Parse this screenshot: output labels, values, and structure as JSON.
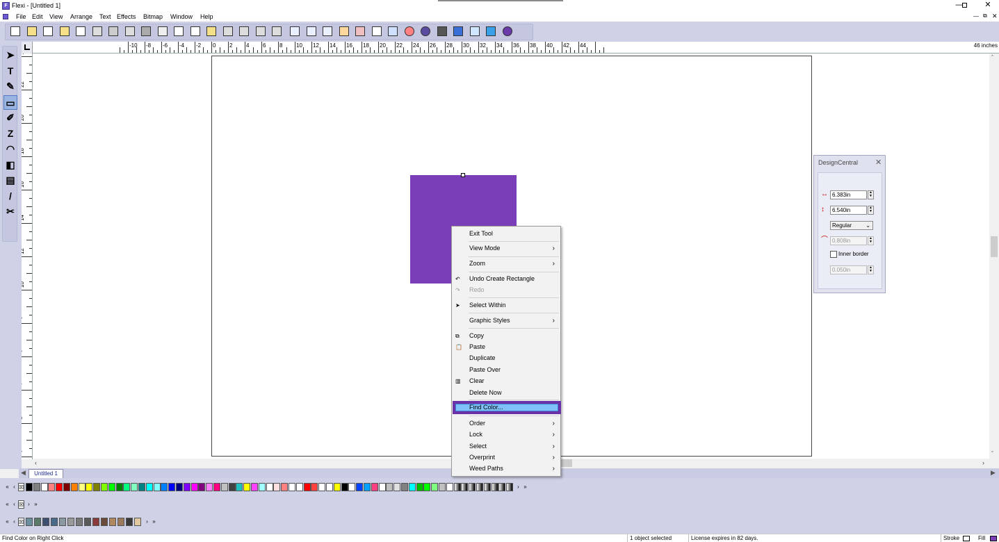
{
  "window": {
    "title": "Flexi - [Untitled 1]",
    "app_icon": "flexi-logo-icon",
    "controls": [
      "minimize-icon",
      "restore-icon",
      "close-icon"
    ]
  },
  "menu": {
    "items": [
      "File",
      "Edit",
      "View",
      "Arrange",
      "Text",
      "Effects",
      "Bitmap",
      "Window",
      "Help"
    ]
  },
  "toolbar": {
    "buttons": [
      "new-icon",
      "open-icon",
      "save-icon",
      "save-as-icon",
      "import-icon",
      "print-icon",
      "cut-to-plotter-icon",
      "rip-print-icon",
      "rip-disabled-icon",
      "production-manager-icon",
      "cut-icon",
      "copy-icon",
      "paste-icon",
      "undo-icon",
      "undo-more-icon",
      "redo-icon",
      "redo-more-icon",
      "design-central-icon",
      "align-icon",
      "group-icon",
      "color-palette-icon",
      "color-picker-icon",
      "swatch-grid-icon",
      "bitmap-icon",
      "color-wheel-icon",
      "er-badge-icon",
      "stripes-icon",
      "edit-icon",
      "cloud-sync-icon",
      "upload-icon",
      "plugin-icon"
    ]
  },
  "ruler": {
    "units": "46 inches",
    "top_labels": [
      "-10",
      "-8",
      "-6",
      "-4",
      "-2",
      "0",
      "2",
      "4",
      "6",
      "8",
      "10",
      "12",
      "14",
      "16",
      "18",
      "20",
      "22",
      "24",
      "26",
      "28",
      "30",
      "32",
      "34",
      "36",
      "38",
      "40",
      "42",
      "44"
    ],
    "left_labels": [
      "24",
      "22",
      "20",
      "18",
      "16",
      "14",
      "12",
      "10",
      "8",
      "6",
      "4",
      "2",
      "0"
    ]
  },
  "tools": [
    "select-tool-icon",
    "text-tool-icon",
    "shape-edit-tool-icon",
    "rectangle-tool-icon",
    "fill-tool-icon",
    "zigzag-tool-icon",
    "contour-tool-icon",
    "shadow-tool-icon",
    "measure-tool-icon",
    "eyedropper-tool-icon",
    "knife-tool-icon"
  ],
  "canvas": {
    "shape_color": "#7a3fb8"
  },
  "context_menu": {
    "items": [
      {
        "label": "Exit Tool",
        "submenu": false,
        "icon": ""
      },
      {
        "label": "View Mode",
        "submenu": true,
        "icon": ""
      },
      {
        "label": "Zoom",
        "submenu": true,
        "icon": ""
      },
      {
        "label": "Undo Create Rectangle",
        "submenu": false,
        "icon": "undo-icon"
      },
      {
        "label": "Redo",
        "submenu": false,
        "icon": "redo-icon",
        "disabled": true
      },
      {
        "label": "Select Within",
        "submenu": false,
        "icon": "select-arrow-icon"
      },
      {
        "label": "Graphic Styles",
        "submenu": true,
        "icon": ""
      },
      {
        "label": "Copy",
        "submenu": false,
        "icon": "copy-icon"
      },
      {
        "label": "Paste",
        "submenu": false,
        "icon": "paste-icon"
      },
      {
        "label": "Duplicate",
        "submenu": false,
        "icon": ""
      },
      {
        "label": "Paste Over",
        "submenu": false,
        "icon": ""
      },
      {
        "label": "Clear",
        "submenu": false,
        "icon": "clear-icon"
      },
      {
        "label": "Delete Now",
        "submenu": false,
        "icon": ""
      },
      {
        "label": "Find Color...",
        "submenu": false,
        "icon": "",
        "highlighted": true
      },
      {
        "label": "Order",
        "submenu": true,
        "icon": ""
      },
      {
        "label": "Lock",
        "submenu": true,
        "icon": ""
      },
      {
        "label": "Select",
        "submenu": true,
        "icon": ""
      },
      {
        "label": "Overprint",
        "submenu": true,
        "icon": ""
      },
      {
        "label": "Weed Paths",
        "submenu": true,
        "icon": ""
      }
    ],
    "submenu_arrow": "›",
    "highlight_color": "#6b31a8"
  },
  "design_central": {
    "title": "DesignCentral",
    "width_value": "6.383in",
    "height_value": "6.540in",
    "corner_style": "Regular",
    "corner_radius": "0.808in",
    "inner_border_label": "Inner border",
    "inner_border_value": "0.050in"
  },
  "tabs": {
    "document": "Untitled 1"
  },
  "palette": {
    "row1": [
      "#000000",
      "#808080",
      "#ffffff",
      "#ff8080",
      "#ff0000",
      "#800000",
      "#ff8000",
      "#ffff80",
      "#ffff00",
      "#808000",
      "#80ff00",
      "#00ff00",
      "#008000",
      "#00ff80",
      "#80ffc0",
      "#008080",
      "#00ffff",
      "#80ffff",
      "#0080ff",
      "#0000ff",
      "#000080",
      "#8000ff",
      "#ff00ff",
      "#800080",
      "#ff80ff",
      "#ff0080",
      "#c0c0c0",
      "#404040"
    ],
    "row1_patterns": [
      "#20c0c0",
      "#ffff00",
      "#ff40ff",
      "#a0ffff",
      "#ffffff",
      "#ffe0e0",
      "#ff8080",
      "#ffffff",
      "#ffffff",
      "#ff0000",
      "#ff4040",
      "#ffffff",
      "#ffffff",
      "#ffff00",
      "#000000",
      "#ffffff",
      "#0040ff",
      "#00a0ff",
      "#ff4080",
      "#ffffff",
      "#c0c0c0",
      "#e0e0e0",
      "#808080",
      "#00ffff",
      "#00c000",
      "#00ff00",
      "#80ff80",
      "#c0c0c0",
      "#ffffff"
    ],
    "row3": [
      "#6b8f9f",
      "#5b7a6a",
      "#3f4f6f",
      "#4a6a8a",
      "#8a9aa0",
      "#9a9a9a",
      "#7a7a7a",
      "#5a5a5a",
      "#8a3a3a",
      "#6a4a3a",
      "#b08860",
      "#9a7a5a",
      "#3a3a3a",
      "#e0c8a0"
    ]
  },
  "status": {
    "hint": "Find Color on Right Click",
    "selection": "1 object selected",
    "license": "License expires in 82 days.",
    "stroke_label": "Stroke",
    "fill_label": "Fill"
  }
}
